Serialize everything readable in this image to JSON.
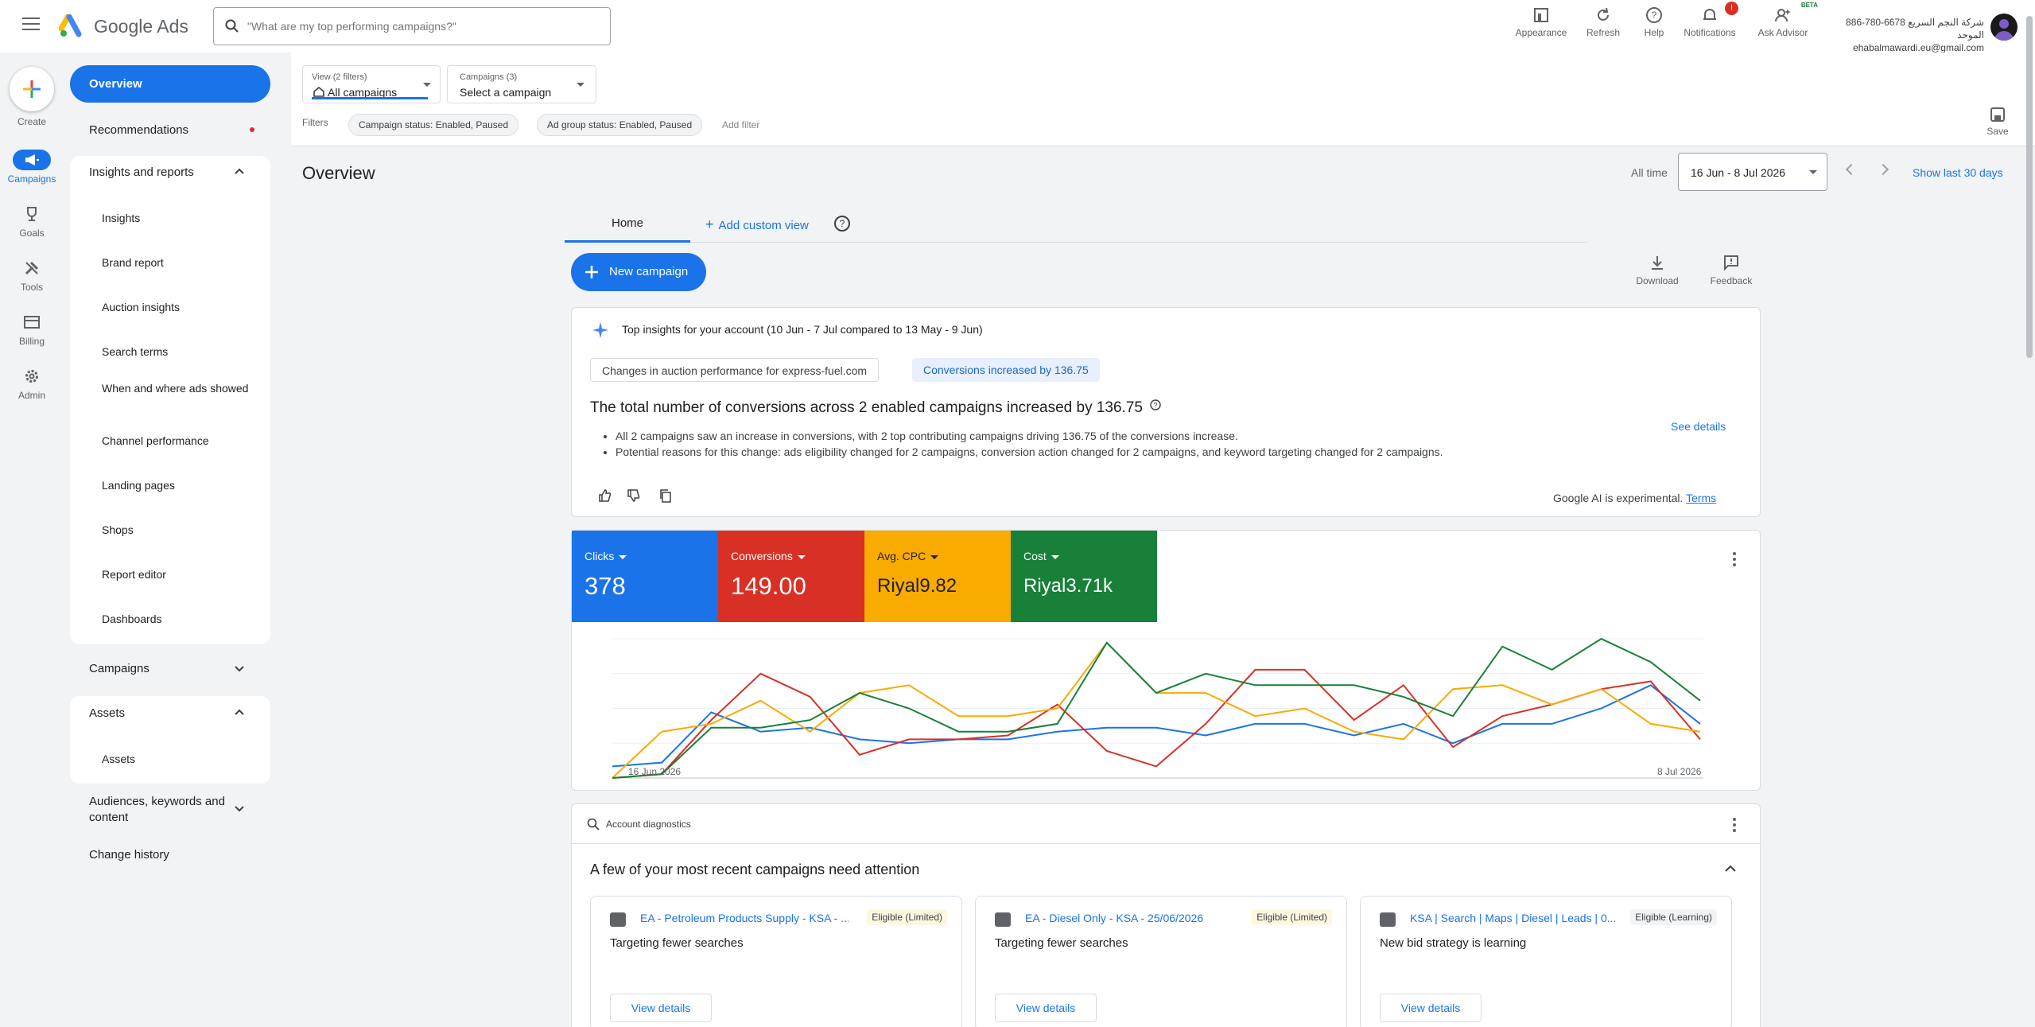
{
  "app": {
    "brand": "Google Ads"
  },
  "search": {
    "placeholder": "\"What are my top performing campaigns?\""
  },
  "header_tools": [
    {
      "label": "Appearance",
      "icon": "appearance-icon"
    },
    {
      "label": "Refresh",
      "icon": "refresh-icon"
    },
    {
      "label": "Help",
      "icon": "help-icon"
    },
    {
      "label": "Notifications",
      "icon": "bell-icon",
      "badge": "!"
    },
    {
      "label": "Ask Advisor",
      "icon": "advisor-icon",
      "tag": "BETA"
    }
  ],
  "account": {
    "line1": "886-780-6678 شركة النجم السريع الموحد",
    "line2": "ehabalmawardi.eu@gmail.com"
  },
  "rail": [
    {
      "label": "Create",
      "icon": "plus-icon"
    },
    {
      "label": "Campaigns",
      "icon": "megaphone-icon",
      "active": true
    },
    {
      "label": "Goals",
      "icon": "trophy-icon"
    },
    {
      "label": "Tools",
      "icon": "tools-icon"
    },
    {
      "label": "Billing",
      "icon": "card-icon"
    },
    {
      "label": "Admin",
      "icon": "gear-icon"
    }
  ],
  "nav": {
    "overview": "Overview",
    "recommendations": "Recommendations",
    "insights_reports": "Insights and reports",
    "insights_sub": [
      "Insights",
      "Brand report",
      "Auction insights",
      "Search terms",
      "When and where ads showed",
      "Channel performance",
      "Landing pages",
      "Shops",
      "Report editor",
      "Dashboards"
    ],
    "campaigns": "Campaigns",
    "assets": "Assets",
    "assets_sub": [
      "Assets"
    ],
    "audiences": "Audiences, keywords and content",
    "change_history": "Change history"
  },
  "filters": {
    "view_label": "View (2 filters)",
    "view_value": "All campaigns",
    "campaigns_label": "Campaigns (3)",
    "campaigns_value": "Select a campaign",
    "filters_label": "Filters",
    "chips": [
      "Campaign status: Enabled, Paused",
      "Ad group status: Enabled, Paused"
    ],
    "add_filter": "Add filter",
    "save": "Save"
  },
  "overview": {
    "title": "Overview",
    "all_time": "All time",
    "date_range": "16 Jun - 8 Jul 2026",
    "show_last": "Show last 30 days",
    "tab_home": "Home",
    "tab_add": "Add custom view",
    "new_campaign": "New campaign",
    "download": "Download",
    "feedback": "Feedback"
  },
  "insights": {
    "title": "Top insights for your account (10 Jun - 7 Jul compared to 13 May - 9 Jun)",
    "chip1": "Changes in auction performance for express-fuel.com",
    "chip2": "Conversions increased by 136.75",
    "headline": "The total number of conversions across 2 enabled campaigns increased by 136.75",
    "bullet1": "All 2 campaigns saw an increase in conversions, with 2 top contributing campaigns driving 136.75 of the conversions increase.",
    "bullet2": "Potential reasons for this change: ads eligibility changed for 2 campaigns, conversion action changed for 2 campaigns, and keyword targeting changed for 2 campaigns.",
    "see_details": "See details",
    "ai_note": "Google AI is experimental.",
    "terms": "Terms"
  },
  "metrics": [
    {
      "label": "Clicks",
      "value": "378",
      "color": "#1a73e8"
    },
    {
      "label": "Conversions",
      "value": "149.00",
      "color": "#d93025"
    },
    {
      "label": "Avg. CPC",
      "value": "Riyal9.82",
      "color": "#f9ab00"
    },
    {
      "label": "Cost",
      "value": "Riyal3.71k",
      "color": "#188038"
    }
  ],
  "chart_data": {
    "type": "line",
    "x_start": "16 Jun 2026",
    "x_end": "8 Jul 2026",
    "series": [
      {
        "name": "Clicks",
        "color": "#1a73e8",
        "values": [
          3,
          4,
          17,
          12,
          13,
          10,
          9,
          10,
          10,
          12,
          13,
          13,
          11,
          14,
          14,
          11,
          14,
          9,
          14,
          14,
          18,
          24,
          14
        ]
      },
      {
        "name": "Conversions",
        "color": "#d93025",
        "values": [
          0,
          1,
          15,
          27,
          21,
          6,
          10,
          10,
          11,
          19,
          7,
          3,
          14,
          28,
          28,
          15,
          24,
          8,
          16,
          19,
          23,
          25,
          10
        ]
      },
      {
        "name": "Avg. CPC",
        "color": "#f9ab00",
        "values": [
          0,
          12,
          14,
          20,
          12,
          22,
          24,
          16,
          16,
          18,
          35,
          22,
          22,
          16,
          18,
          12,
          10,
          23,
          24,
          19,
          23,
          14,
          12
        ]
      },
      {
        "name": "Cost",
        "color": "#188038",
        "values": [
          0,
          1,
          13,
          13,
          15,
          22,
          18,
          12,
          12,
          14,
          35,
          22,
          27,
          24,
          24,
          24,
          21,
          16,
          34,
          28,
          36,
          30,
          20
        ]
      }
    ]
  },
  "diagnostics": {
    "label": "Account diagnostics",
    "headline": "A few of your most recent campaigns need attention",
    "cards": [
      {
        "name": "EA - Petroleum Products Supply - KSA - ...",
        "badge": "Eligible (Limited)",
        "desc": "Targeting fewer searches",
        "button": "View details"
      },
      {
        "name": "EA - Diesel Only - KSA - 25/06/2026",
        "badge": "Eligible (Limited)",
        "desc": "Targeting fewer searches",
        "button": "View details"
      },
      {
        "name": "KSA | Search | Maps | Diesel | Leads | 0...",
        "badge": "Eligible (Learning)",
        "desc": "New bid strategy is learning",
        "button": "View details"
      }
    ]
  }
}
